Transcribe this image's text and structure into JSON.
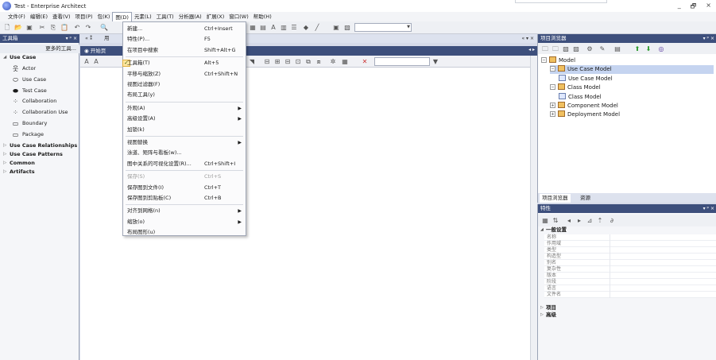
{
  "window": {
    "title": "Test - Enterprise Architect",
    "controls": [
      "_",
      "🗗",
      "×"
    ]
  },
  "menubar": [
    {
      "label": "文件(F)"
    },
    {
      "label": "编辑(E)"
    },
    {
      "label": "查看(V)"
    },
    {
      "label": "项目(P)"
    },
    {
      "label": "包(K)"
    },
    {
      "label": "图(D)",
      "active": true
    },
    {
      "label": "元素(L)"
    },
    {
      "label": "工具(T)"
    },
    {
      "label": "分析器(A)"
    },
    {
      "label": "扩展(X)"
    },
    {
      "label": "窗口(W)"
    },
    {
      "label": "帮助(H)"
    }
  ],
  "diagram_menu": {
    "groups": [
      [
        {
          "label": "新建...",
          "shortcut": "Ctrl+Insert"
        },
        {
          "label": "特性(P)...",
          "shortcut": "F5"
        },
        {
          "label": "在项目中搜索",
          "shortcut": "Shift+Alt+G"
        }
      ],
      [
        {
          "label": "工具箱(T)",
          "shortcut": "Alt+5",
          "checked": true
        },
        {
          "label": "平移与缩放(Z)",
          "shortcut": "Ctrl+Shift+N"
        },
        {
          "label": "视图过滤器(F)",
          "shortcut": ""
        },
        {
          "label": "布局工具(y)",
          "shortcut": ""
        }
      ],
      [
        {
          "label": "外观(A)",
          "submenu": true
        },
        {
          "label": "高级设置(A)",
          "submenu": true
        },
        {
          "label": "加锁(k)",
          "shortcut": ""
        }
      ],
      [
        {
          "label": "视图替换",
          "submenu": true
        },
        {
          "label": "泳道、矩阵与看板(w)...",
          "shortcut": ""
        },
        {
          "label": "图中关系的可视化设置(R)...",
          "shortcut": "Ctrl+Shift+I"
        }
      ],
      [
        {
          "label": "保存(S)",
          "shortcut": "Ctrl+S",
          "disabled": true
        },
        {
          "label": "保存图到文件(I)",
          "shortcut": "Ctrl+T"
        },
        {
          "label": "保存图到剪贴板(C)",
          "shortcut": "Ctrl+B"
        }
      ],
      [
        {
          "label": "对齐到网格(n)",
          "submenu": true
        },
        {
          "label": "缩放(o)",
          "submenu": true
        },
        {
          "label": "布局图形(u)",
          "shortcut": ""
        }
      ]
    ]
  },
  "toolbox": {
    "title": "工具箱",
    "more_link": "更多的工具...",
    "open_group": "Use Case",
    "items": [
      {
        "label": "Actor",
        "icon": "actor-icon",
        "glyph": "웃"
      },
      {
        "label": "Use Case",
        "icon": "use-case-icon",
        "glyph": "⬭"
      },
      {
        "label": "Test Case",
        "icon": "test-case-icon",
        "glyph": "⬬"
      },
      {
        "label": "Collaboration",
        "icon": "collaboration-icon",
        "glyph": "⁘"
      },
      {
        "label": "Collaboration Use",
        "icon": "collaboration-use-icon",
        "glyph": "⁘"
      },
      {
        "label": "Boundary",
        "icon": "boundary-icon",
        "glyph": "▭"
      },
      {
        "label": "Package",
        "icon": "package-icon",
        "glyph": "▭"
      }
    ],
    "closed_groups": [
      "Use Case Relationships",
      "Use Case Patterns",
      "Common",
      "Artifacts"
    ]
  },
  "document_tabs": {
    "partial_label": "用",
    "start_page": "开始页",
    "controls": "« ▾ ×"
  },
  "project_browser": {
    "title": "项目浏览器",
    "tree": [
      {
        "label": "Model",
        "level": 0,
        "expander": "⊟"
      },
      {
        "label": "Use Case Model",
        "level": 1,
        "expander": "⊟",
        "selected": true
      },
      {
        "label": "Use Case Model",
        "level": 2,
        "expander": ""
      },
      {
        "label": "Class Model",
        "level": 1,
        "expander": "⊟"
      },
      {
        "label": "Class Model",
        "level": 2,
        "expander": ""
      },
      {
        "label": "Component Model",
        "level": 1,
        "expander": "⊞"
      },
      {
        "label": "Deployment Model",
        "level": 1,
        "expander": "⊞"
      }
    ],
    "tabs": [
      {
        "label": "项目浏览器",
        "active": true
      },
      {
        "label": "资源",
        "active": false
      }
    ]
  },
  "properties": {
    "title": "特性",
    "general_section": "一般设置",
    "rows": [
      "名称",
      "作用域",
      "类型",
      "构造型",
      "别名",
      "复杂性",
      "版本",
      "阶段",
      "语言",
      "文件名"
    ],
    "collapsed_sections": [
      "项目",
      "高级"
    ]
  },
  "colors": {
    "panel_header": "#3d4f7c",
    "menu_selection": "#c5d4f0",
    "check_highlight": "#ffe6a0"
  }
}
